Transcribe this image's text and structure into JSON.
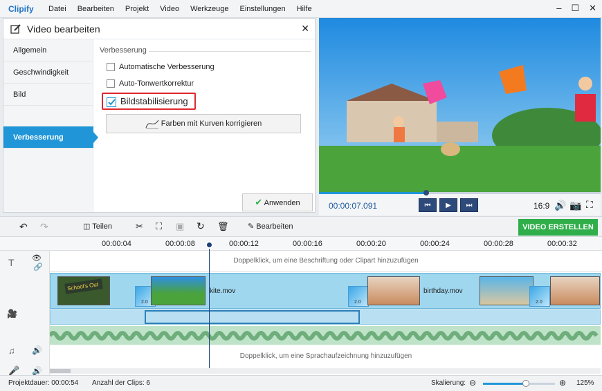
{
  "app": {
    "logo": "Clipify"
  },
  "menu": [
    "Datei",
    "Bearbeiten",
    "Projekt",
    "Video",
    "Werkzeuge",
    "Einstellungen",
    "Hilfe"
  ],
  "window_controls": {
    "minimize": "–",
    "maximize": "☐",
    "close": "✕"
  },
  "panel": {
    "title": "Video bearbeiten",
    "close": "✕",
    "tabs": [
      "Allgemein",
      "Geschwindigkeit",
      "Bild",
      "Verbesserung"
    ],
    "active_tab": "Verbesserung",
    "section_title": "Verbesserung",
    "options": [
      {
        "label": "Automatische Verbesserung",
        "checked": false
      },
      {
        "label": "Auto-Tonwertkorrektur",
        "checked": false
      },
      {
        "label": "Bildstabilisierung",
        "checked": true
      }
    ],
    "curves_button": "Farben mit Kurven korrigieren",
    "apply_button": "Anwenden"
  },
  "player": {
    "time": "00:00:07.091",
    "aspect": "16:9",
    "progress": 0.38
  },
  "toolbar": {
    "split": "Teilen",
    "edit": "Bearbeiten",
    "create": "VIDEO ERSTELLEN"
  },
  "timeline": {
    "ticks": [
      "00:00:04",
      "00:00:08",
      "00:00:12",
      "00:00:16",
      "00:00:20",
      "00:00:24",
      "00:00:28",
      "00:00:32"
    ],
    "text_track_hint": "Doppelklick, um eine Beschriftung oder Clipart hinzuzufügen",
    "voice_track_hint": "Doppelklick, um eine Sprachaufzeichnung hinzuzufügen",
    "clip_labels": [
      "kite.mov",
      "birthday.mov"
    ],
    "transition_label": "2.0",
    "school_text": "School's Out"
  },
  "status": {
    "duration_label": "Projektdauer:",
    "duration": "00:00:54",
    "clips_label": "Anzahl der Clips:",
    "clips": "6",
    "zoom_label": "Skalierung:",
    "zoom": "125%",
    "zoom_level": 0.6
  },
  "colors": {
    "accent": "#2096d8",
    "create": "#2fae4a",
    "highlight": "#e0282e",
    "timeline_track": "#9fd7ef"
  }
}
